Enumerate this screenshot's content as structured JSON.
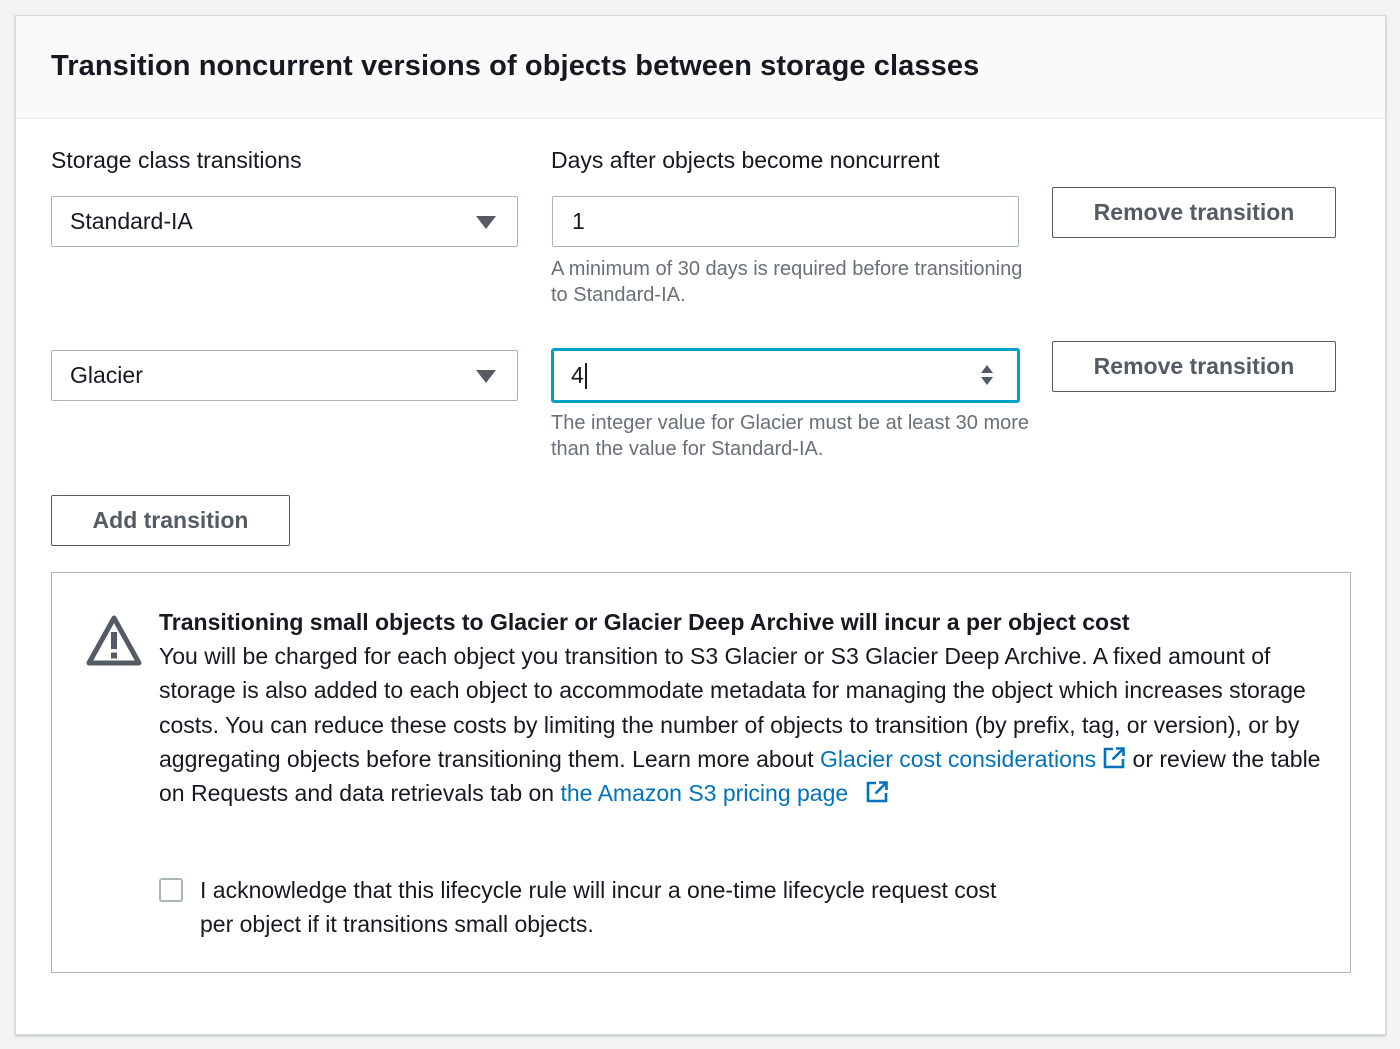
{
  "header": {
    "title": "Transition noncurrent versions of objects between storage classes"
  },
  "columns": {
    "storage_class_label": "Storage class transitions",
    "days_label": "Days after objects become noncurrent"
  },
  "transitions": [
    {
      "storage_class": "Standard-IA",
      "days": "1",
      "hint": "A minimum of 30 days is required before transitioning to Standard-IA.",
      "remove_label": "Remove transition"
    },
    {
      "storage_class": "Glacier",
      "days": "4",
      "hint": "The integer value for Glacier must be at least 30 more than the value for Standard-IA.",
      "remove_label": "Remove transition"
    }
  ],
  "add_transition_label": "Add transition",
  "alert": {
    "icon": "warning-icon",
    "title": "Transitioning small objects to Glacier or Glacier Deep Archive will incur a per object cost",
    "body_part1": "You will be charged for each object you transition to S3 Glacier or S3 Glacier Deep Archive. A fixed amount of storage is also added to each object to accommodate metadata for managing the object which increases storage costs. You can reduce these costs by limiting the number of objects to transition (by prefix, tag, or version), or by aggregating objects before transitioning them. Learn more about ",
    "link1_label": "Glacier cost considerations",
    "body_part2": " or review the table on Requests and data retrievals tab on ",
    "link2_label": "the Amazon S3 pricing page",
    "acknowledge_label": "I acknowledge that this lifecycle rule will incur a one-time lifecycle request cost per object if it transitions small objects."
  },
  "colors": {
    "link": "#0073bb",
    "focus": "#00a1c9",
    "border": "#aab7b8",
    "button_text": "#545b64"
  }
}
